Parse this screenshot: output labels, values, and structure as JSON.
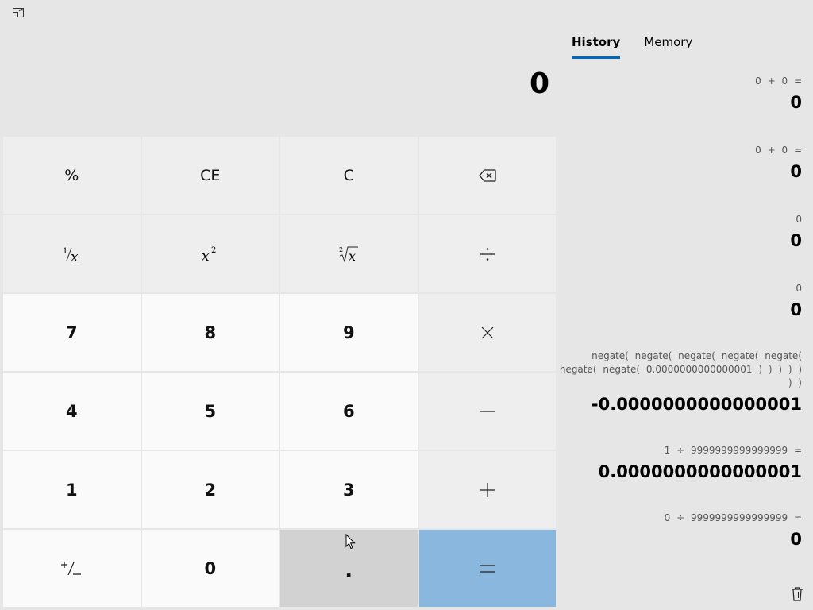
{
  "display": {
    "value": "0"
  },
  "keys": {
    "percent": "%",
    "ce": "CE",
    "c": "C",
    "num7": "7",
    "num8": "8",
    "num9": "9",
    "num4": "4",
    "num5": "5",
    "num6": "6",
    "num1": "1",
    "num2": "2",
    "num3": "3",
    "num0": "0",
    "decimal": "."
  },
  "tabs": [
    {
      "label": "History",
      "active": true
    },
    {
      "label": "Memory",
      "active": false
    }
  ],
  "history": [
    {
      "expression": "0 + 0 =",
      "result": "0"
    },
    {
      "expression": "0 + 0 =",
      "result": "0"
    },
    {
      "expression": "0",
      "result": "0"
    },
    {
      "expression": "0",
      "result": "0"
    },
    {
      "expression": "negate( negate( negate( negate( negate( negate( negate( 0.0000000000000001 ) ) ) ) ) ) )",
      "result": "-0.0000000000000001"
    },
    {
      "expression": "1 ÷ 9999999999999999 =",
      "result": "0.0000000000000001"
    },
    {
      "expression": "0 ÷ 9999999999999999 =",
      "result": "0"
    }
  ],
  "colors": {
    "background": "#e6e6e6",
    "accent": "#0067c0",
    "equals_key": "#8ab7dd",
    "pressed_key": "#d2d2d2"
  },
  "icons": {
    "mode_toggle": "keep-on-top-icon",
    "backspace": "backspace-icon",
    "clear_history": "trash-icon"
  }
}
